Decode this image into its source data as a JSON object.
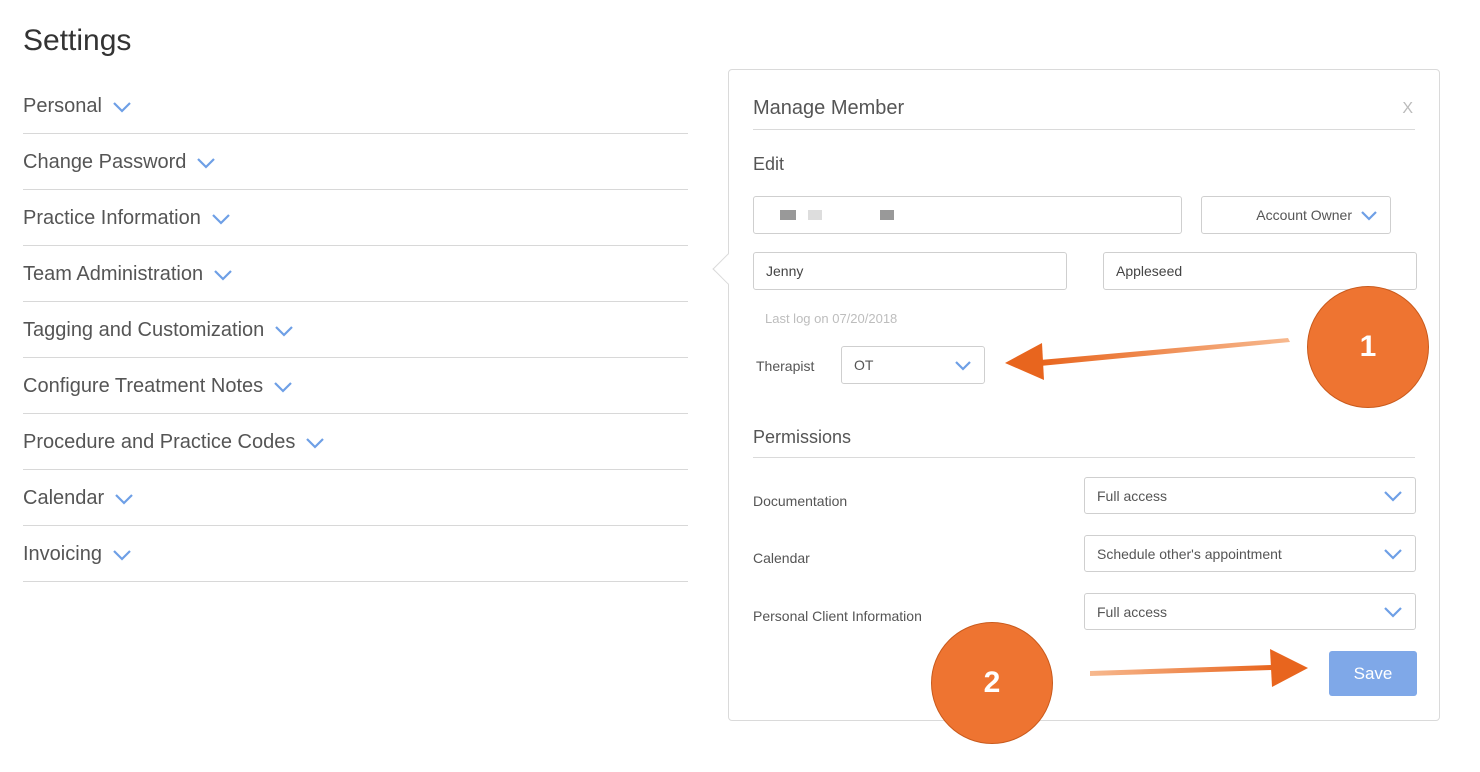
{
  "page": {
    "title": "Settings"
  },
  "settings_sections": [
    {
      "label": "Personal"
    },
    {
      "label": "Change Password"
    },
    {
      "label": "Practice Information"
    },
    {
      "label": "Team Administration"
    },
    {
      "label": "Tagging and Customization"
    },
    {
      "label": "Configure Treatment Notes"
    },
    {
      "label": "Procedure and Practice Codes"
    },
    {
      "label": "Calendar"
    },
    {
      "label": "Invoicing"
    }
  ],
  "modal": {
    "title": "Manage Member",
    "close_label": "X",
    "edit": {
      "section_label": "Edit",
      "role_value": "Account Owner",
      "first_name_value": "Jenny",
      "last_name_value": "Appleseed",
      "last_log_text": "Last log on 07/20/2018",
      "therapist_label": "Therapist",
      "therapist_value": "OT"
    },
    "permissions": {
      "section_label": "Permissions",
      "rows": [
        {
          "label": "Documentation",
          "value": "Full access"
        },
        {
          "label": "Calendar",
          "value": "Schedule other's appointment"
        },
        {
          "label": "Personal Client Information",
          "value": "Full access"
        }
      ]
    },
    "save_label": "Save"
  },
  "annotations": {
    "callout_1": "1",
    "callout_2": "2"
  },
  "colors": {
    "accent": "#7fa8e8",
    "chevron": "#6e9fe6",
    "annotation": "#ee7431"
  },
  "icons": {
    "section_toggle": "chevron-down-icon",
    "select_toggle": "chevron-down-icon"
  }
}
